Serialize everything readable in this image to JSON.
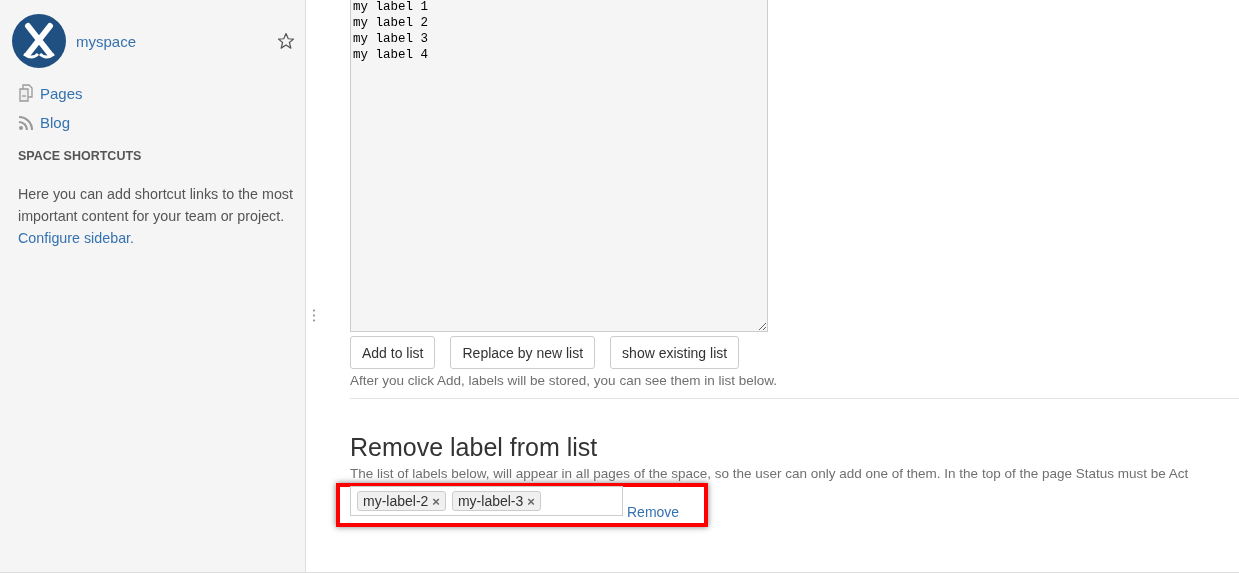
{
  "sidebar": {
    "space_name": "myspace",
    "starred": false,
    "nav": [
      {
        "label": "Pages",
        "kind": "pages"
      },
      {
        "label": "Blog",
        "kind": "blog"
      }
    ],
    "shortcuts_heading": "SPACE SHORTCUTS",
    "shortcuts_text": "Here you can add shortcut links to the most important content for your team or project.",
    "configure_link": "Configure sidebar."
  },
  "labels_textarea": {
    "value": "my label 1\nmy label 2\nmy label 3\nmy label 4"
  },
  "buttons": [
    "Add to list",
    "Replace by new list",
    "show existing list"
  ],
  "add_hint": "After you click Add, labels will be stored, you can see them in list below.",
  "remove_section": {
    "heading": "Remove label from list",
    "description": "The list of labels below, will appear in all pages of the space, so the user can only add one of them. In the top of the page Status must be Act",
    "chips": [
      "my-label-2",
      "my-label-3"
    ],
    "chip_remove": "×",
    "remove_link": "Remove"
  }
}
